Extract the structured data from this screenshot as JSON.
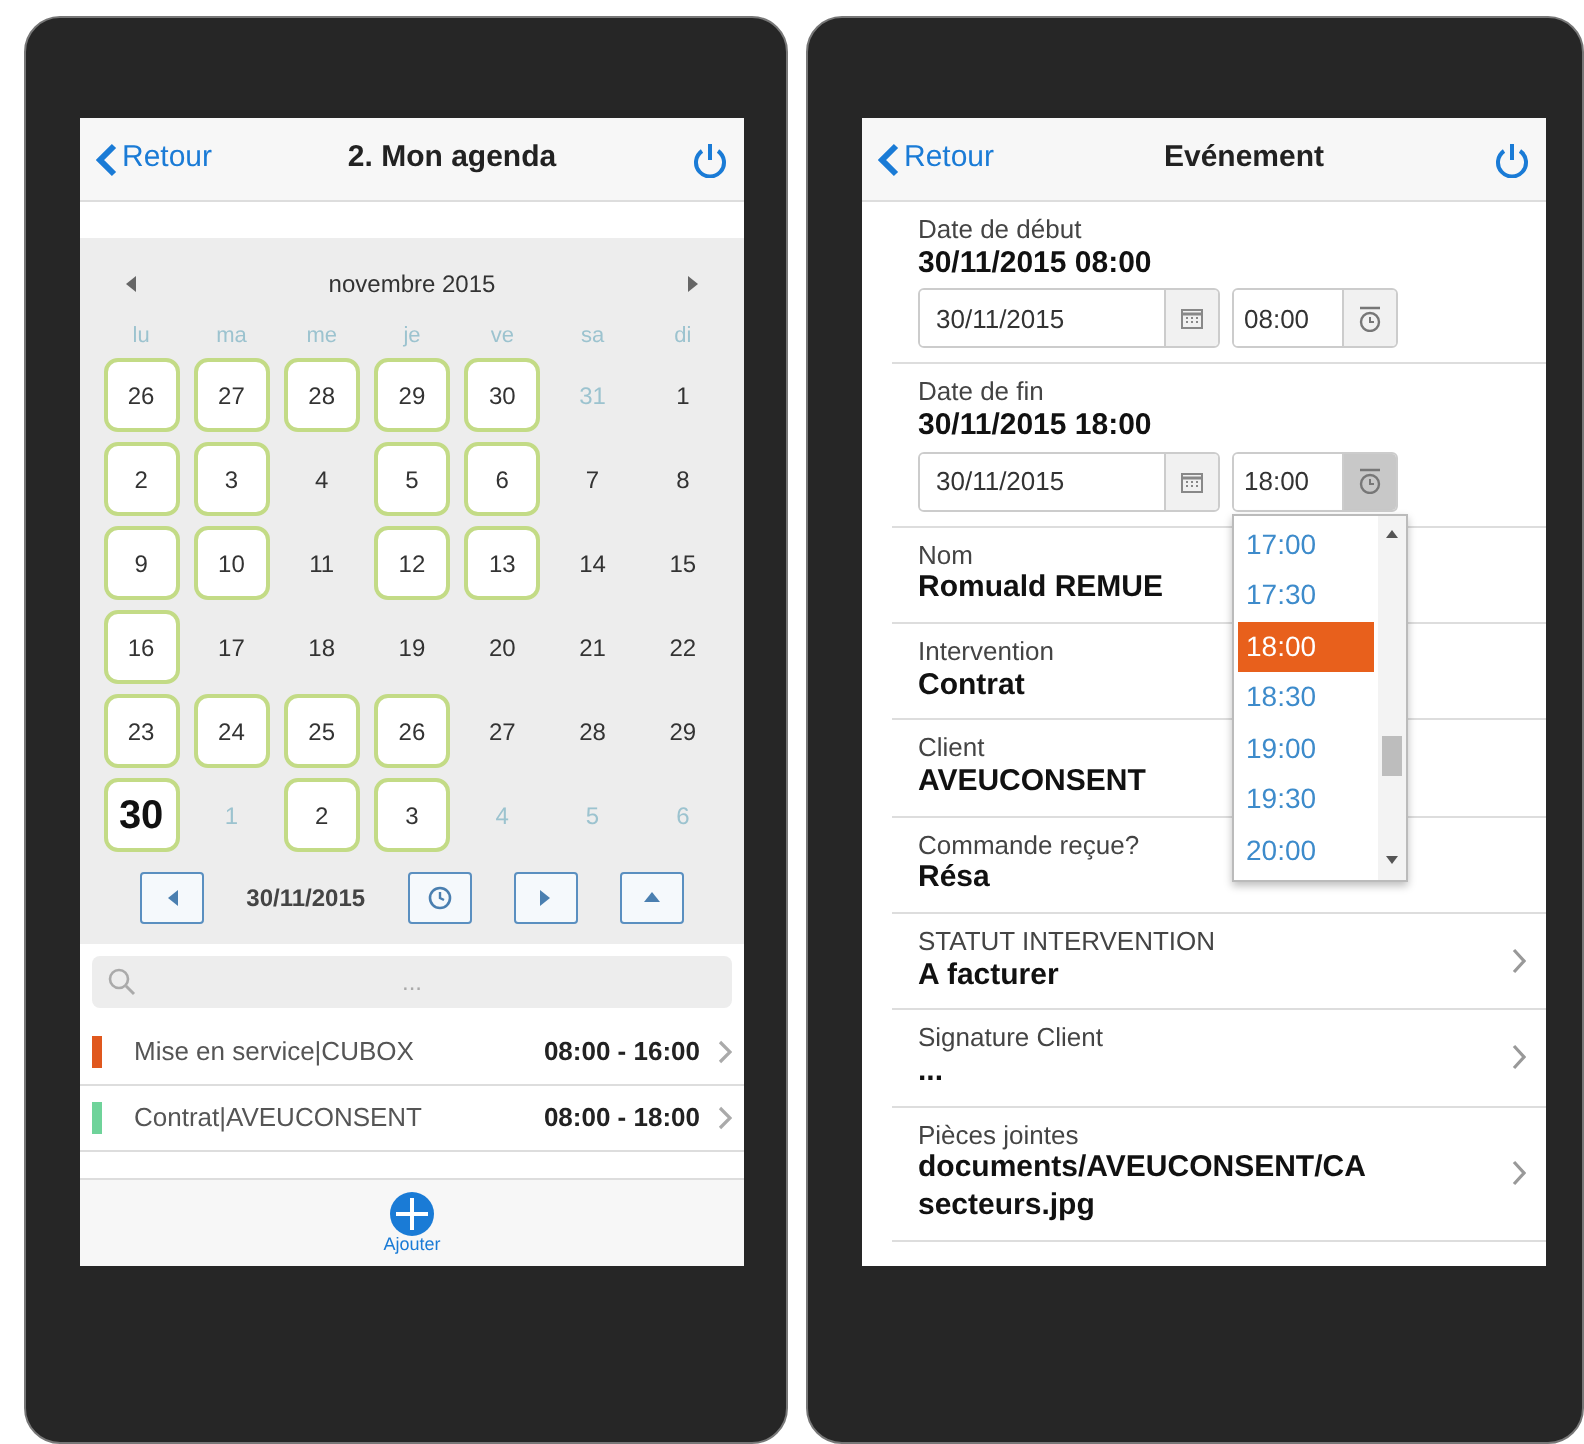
{
  "agenda_screen": {
    "header": {
      "back": "Retour",
      "title": "2. Mon agenda"
    },
    "calendar": {
      "month": "novembre 2015",
      "weekdays": [
        "lu",
        "ma",
        "me",
        "je",
        "ve",
        "sa",
        "di"
      ],
      "weeks": [
        [
          {
            "day": "26",
            "event": true,
            "muted": false,
            "today": false
          },
          {
            "day": "27",
            "event": true,
            "muted": false,
            "today": false
          },
          {
            "day": "28",
            "event": true,
            "muted": false,
            "today": false
          },
          {
            "day": "29",
            "event": true,
            "muted": false,
            "today": false
          },
          {
            "day": "30",
            "event": true,
            "muted": false,
            "today": false
          },
          {
            "day": "31",
            "event": false,
            "muted": true,
            "today": false
          },
          {
            "day": "1",
            "event": false,
            "muted": false,
            "today": false
          }
        ],
        [
          {
            "day": "2",
            "event": true,
            "muted": false,
            "today": false
          },
          {
            "day": "3",
            "event": true,
            "muted": false,
            "today": false
          },
          {
            "day": "4",
            "event": false,
            "muted": false,
            "today": false
          },
          {
            "day": "5",
            "event": true,
            "muted": false,
            "today": false
          },
          {
            "day": "6",
            "event": true,
            "muted": false,
            "today": false
          },
          {
            "day": "7",
            "event": false,
            "muted": false,
            "today": false
          },
          {
            "day": "8",
            "event": false,
            "muted": false,
            "today": false
          }
        ],
        [
          {
            "day": "9",
            "event": true,
            "muted": false,
            "today": false
          },
          {
            "day": "10",
            "event": true,
            "muted": false,
            "today": false
          },
          {
            "day": "11",
            "event": false,
            "muted": false,
            "today": false
          },
          {
            "day": "12",
            "event": true,
            "muted": false,
            "today": false
          },
          {
            "day": "13",
            "event": true,
            "muted": false,
            "today": false
          },
          {
            "day": "14",
            "event": false,
            "muted": false,
            "today": false
          },
          {
            "day": "15",
            "event": false,
            "muted": false,
            "today": false
          }
        ],
        [
          {
            "day": "16",
            "event": true,
            "muted": false,
            "today": false
          },
          {
            "day": "17",
            "event": false,
            "muted": false,
            "today": false
          },
          {
            "day": "18",
            "event": false,
            "muted": false,
            "today": false
          },
          {
            "day": "19",
            "event": false,
            "muted": false,
            "today": false
          },
          {
            "day": "20",
            "event": false,
            "muted": false,
            "today": false
          },
          {
            "day": "21",
            "event": false,
            "muted": false,
            "today": false
          },
          {
            "day": "22",
            "event": false,
            "muted": false,
            "today": false
          }
        ],
        [
          {
            "day": "23",
            "event": true,
            "muted": false,
            "today": false
          },
          {
            "day": "24",
            "event": true,
            "muted": false,
            "today": false
          },
          {
            "day": "25",
            "event": true,
            "muted": false,
            "today": false
          },
          {
            "day": "26",
            "event": true,
            "muted": false,
            "today": false
          },
          {
            "day": "27",
            "event": false,
            "muted": false,
            "today": false
          },
          {
            "day": "28",
            "event": false,
            "muted": false,
            "today": false
          },
          {
            "day": "29",
            "event": false,
            "muted": false,
            "today": false
          }
        ],
        [
          {
            "day": "30",
            "event": true,
            "muted": false,
            "today": true
          },
          {
            "day": "1",
            "event": false,
            "muted": true,
            "today": false
          },
          {
            "day": "2",
            "event": true,
            "muted": false,
            "today": false
          },
          {
            "day": "3",
            "event": true,
            "muted": false,
            "today": false
          },
          {
            "day": "4",
            "event": false,
            "muted": true,
            "today": false
          },
          {
            "day": "5",
            "event": false,
            "muted": true,
            "today": false
          },
          {
            "day": "6",
            "event": false,
            "muted": true,
            "today": false
          }
        ]
      ],
      "current_date": "30/11/2015"
    },
    "search": {
      "placeholder": "..."
    },
    "events": [
      {
        "title": "Mise en service|CUBOX",
        "time": "08:00 - 16:00",
        "color": "#e0581e"
      },
      {
        "title": "Contrat|AVEUCONSENT",
        "time": "08:00 - 18:00",
        "color": "#6fd39a"
      }
    ],
    "footer": {
      "add_label": "Ajouter"
    }
  },
  "event_screen": {
    "header": {
      "back": "Retour",
      "title": "Evénement"
    },
    "fields": [
      {
        "kind": "datetime",
        "label": "Date de début",
        "value": "30/11/2015 08:00",
        "date": "30/11/2015",
        "time": "08:00",
        "picker_open": false
      },
      {
        "kind": "datetime",
        "label": "Date de fin",
        "value": "30/11/2015 18:00",
        "date": "30/11/2015",
        "time": "18:00",
        "picker_open": true,
        "options": [
          {
            "label": "17:00",
            "selected": false
          },
          {
            "label": "17:30",
            "selected": false
          },
          {
            "label": "18:00",
            "selected": true
          },
          {
            "label": "18:30",
            "selected": false
          },
          {
            "label": "19:00",
            "selected": false
          },
          {
            "label": "19:30",
            "selected": false
          },
          {
            "label": "20:00",
            "selected": false
          }
        ]
      },
      {
        "kind": "text",
        "label": "Nom",
        "value": "Romuald REMUE",
        "chevron": false
      },
      {
        "kind": "text",
        "label": "Intervention",
        "value": "Contrat",
        "chevron": false
      },
      {
        "kind": "text",
        "label": "Client",
        "value": "AVEUCONSENT",
        "chevron": false
      },
      {
        "kind": "text",
        "label": "Commande reçue?",
        "value": "Résa",
        "chevron": false
      },
      {
        "kind": "text",
        "label": "STATUT INTERVENTION",
        "value": "A facturer",
        "chevron": true
      },
      {
        "kind": "text",
        "label": "Signature Client",
        "value": "...",
        "chevron": true
      },
      {
        "kind": "text",
        "label": "Pièces jointes",
        "value": "documents/AVEUCONSENT/CA secteurs.jpg",
        "chevron": true
      }
    ]
  }
}
